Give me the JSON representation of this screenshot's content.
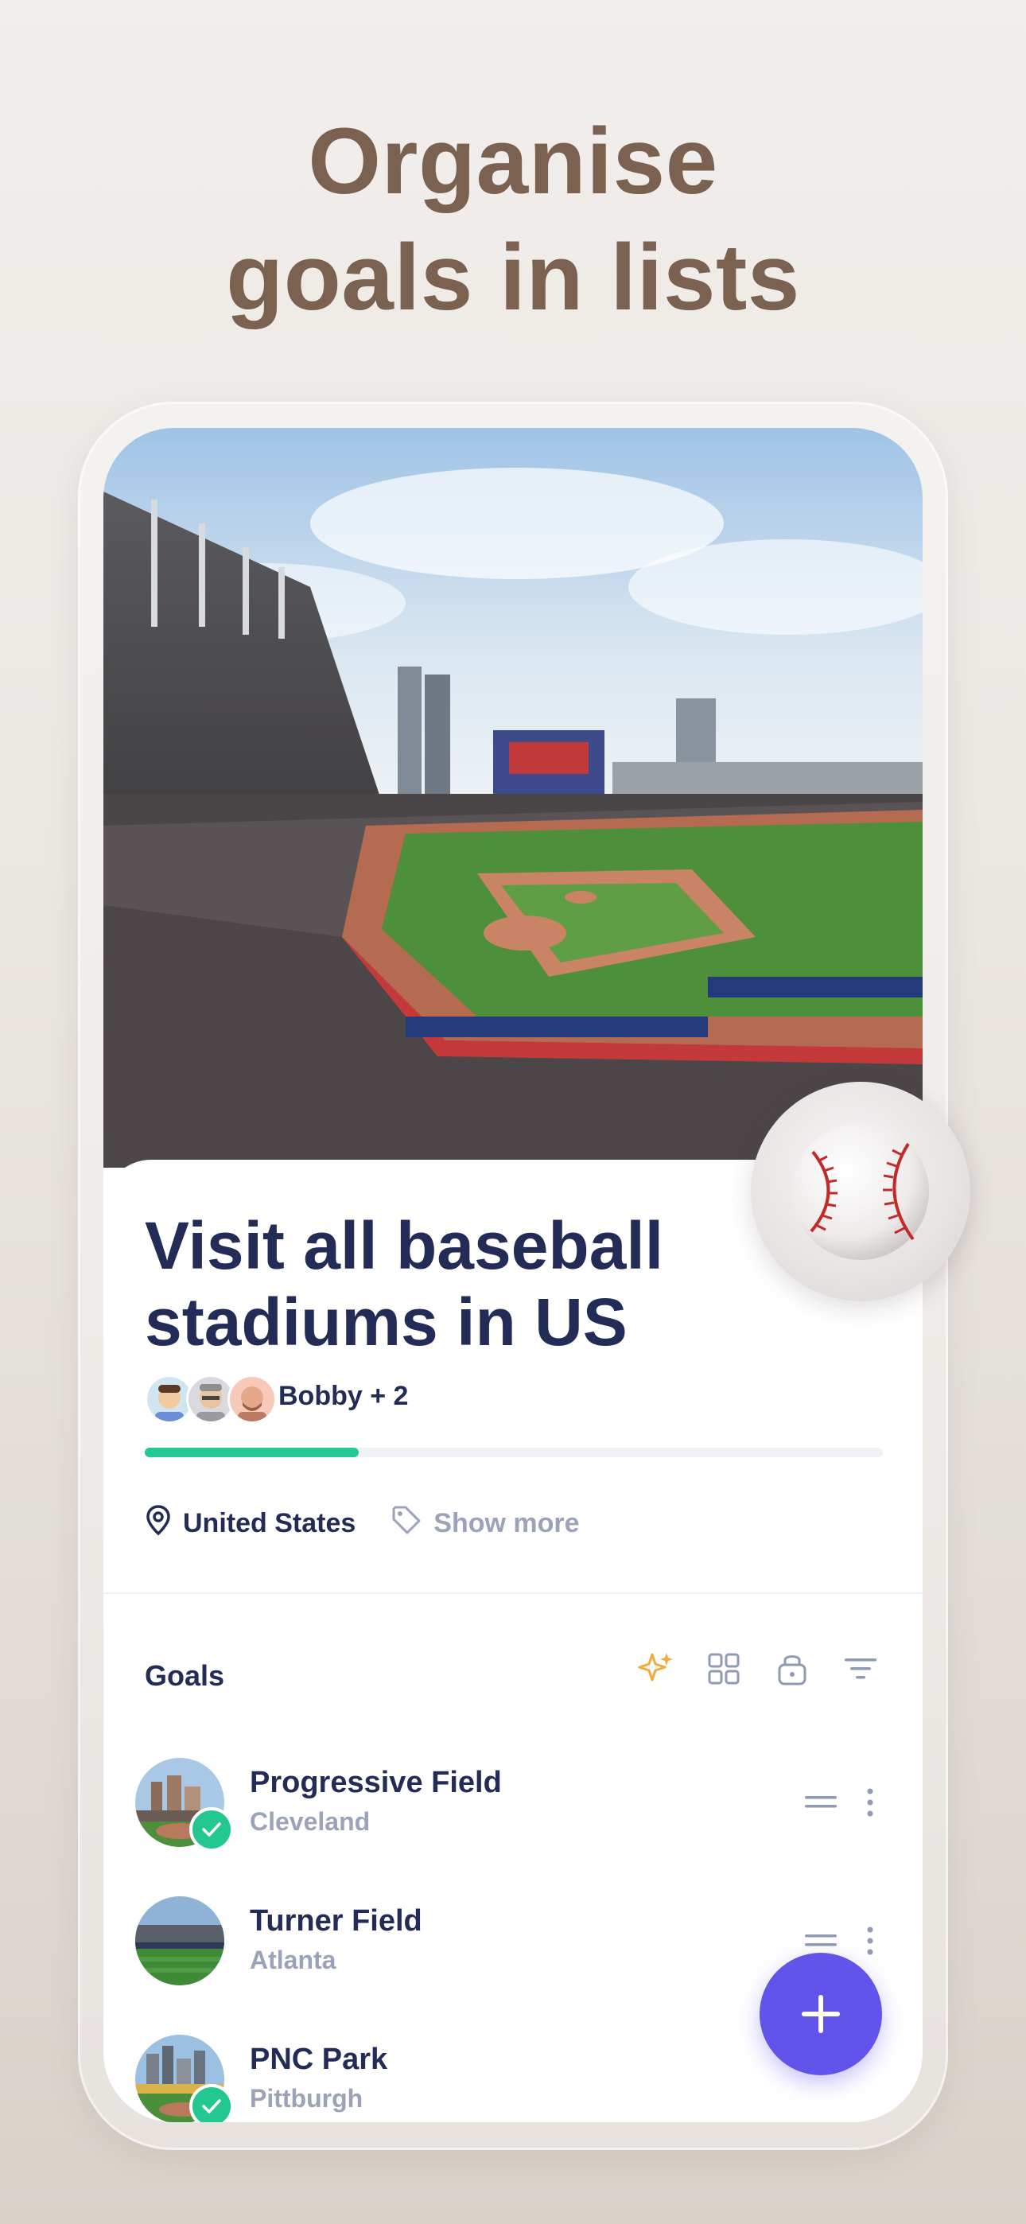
{
  "headline": {
    "line1": "Organise",
    "line2": "goals in lists"
  },
  "list": {
    "title": "Visit all baseball stadiums in US",
    "owner": "Bobby + 2",
    "progress_fraction": 0.29,
    "location": "United States",
    "tags_link": "Show more",
    "hero_image": "baseball-stadium-photo",
    "list_icon": "baseball-icon"
  },
  "goals": {
    "label": "Goals",
    "toolbar_icons": [
      "sparkle-icon",
      "grid-icon",
      "lock-icon",
      "filter-icon"
    ],
    "items": [
      {
        "name": "Progressive Field",
        "city": "Cleveland",
        "completed": true
      },
      {
        "name": "Turner Field",
        "city": "Atlanta",
        "completed": false
      },
      {
        "name": "PNC Park",
        "city": "Pittburgh",
        "completed": true
      }
    ]
  },
  "colors": {
    "headline": "#7a6150",
    "title": "#232c57",
    "progress": "#25c996",
    "muted": "#9aa3b8",
    "fab": "#6254ea",
    "accent_sparkle": "#f5a93a"
  }
}
